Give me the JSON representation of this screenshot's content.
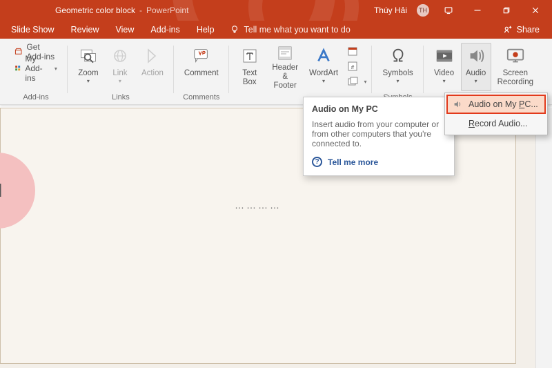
{
  "titlebar": {
    "doc_title": "Geometric color block",
    "sep": " - ",
    "app_name": "PowerPoint",
    "user_name": "Thúy Hải",
    "user_initials": "TH"
  },
  "tabs": {
    "items": [
      "Slide Show",
      "Review",
      "View",
      "Add-ins",
      "Help"
    ],
    "tell_me": "Tell me what you want to do",
    "share": "Share"
  },
  "ribbon": {
    "addins": {
      "label": "Add-ins",
      "get": "Get Add-ins",
      "my": "My Add-ins"
    },
    "links": {
      "label": "Links",
      "zoom": "Zoom",
      "link": "Link",
      "action": "Action"
    },
    "comments": {
      "label": "Comments",
      "comment": "Comment"
    },
    "text": {
      "textbox_l1": "Text",
      "textbox_l2": "Box",
      "header_l1": "Header",
      "header_l2": "& Footer",
      "wordart": "WordArt"
    },
    "symbols": {
      "label": "Symbols",
      "symbols": "Symbols"
    },
    "media": {
      "video": "Video",
      "audio": "Audio",
      "screen_l1": "Screen",
      "screen_l2": "Recording"
    }
  },
  "tooltip": {
    "title": "Audio on My PC",
    "body": "Insert audio from your computer or from other computers that you're connected to.",
    "more": "Tell me more"
  },
  "menu": {
    "audio_pc_pre": "Audio on My ",
    "audio_pc_u": "P",
    "audio_pc_post": "C...",
    "record_u": "R",
    "record_post": "ecord Audio..."
  },
  "slide": {
    "shape_text": "d",
    "dots": "…………"
  }
}
